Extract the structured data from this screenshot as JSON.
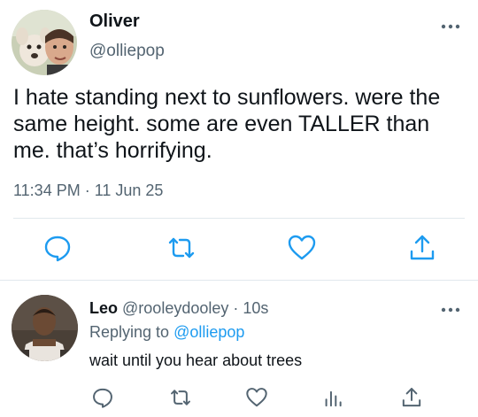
{
  "tweet": {
    "author_name": "Oliver",
    "author_handle": "@olliepop",
    "text": "I hate standing next to sunflowers. were the same height. some are even TALLER than me. that’s horrifying.",
    "timestamp": "11:34 PM · 11 Jun 25",
    "avatar": "avatar-photo-dog-and-person",
    "actions": [
      "reply-icon",
      "retweet-icon",
      "like-icon",
      "share-icon"
    ]
  },
  "reply": {
    "author_name": "Leo",
    "author_handle": "@rooleydooley",
    "time_meta": "· 10s",
    "replying_prefix": "Replying to",
    "replying_handle": "@olliepop",
    "text": "wait until you hear about trees",
    "avatar": "avatar-photo-person",
    "actions": [
      "reply-icon",
      "retweet-icon",
      "like-icon",
      "analytics-icon",
      "share-icon"
    ]
  },
  "colors": {
    "text": "#0f1419",
    "secondary": "#536471",
    "link": "#1d9bf0",
    "divider": "#e1e8ed",
    "icon": "#1d9bf0"
  }
}
